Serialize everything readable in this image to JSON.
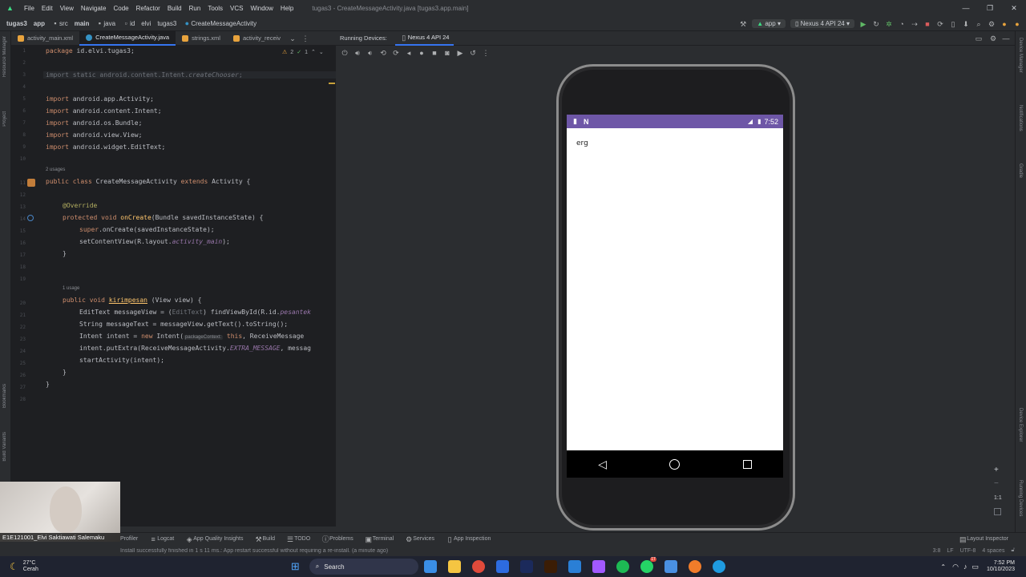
{
  "menubar": {
    "items": [
      "File",
      "Edit",
      "View",
      "Navigate",
      "Code",
      "Refactor",
      "Build",
      "Run",
      "Tools",
      "VCS",
      "Window",
      "Help"
    ],
    "title": "tugas3 - CreateMessageActivity.java [tugas3.app.main]"
  },
  "navbar": {
    "crumbs": [
      "tugas3",
      "app",
      "src",
      "main",
      "java",
      "id",
      "elvi",
      "tugas3",
      "CreateMessageActivity"
    ],
    "run_config": "app",
    "device": "Nexus 4 API 24"
  },
  "tabs": {
    "items": [
      "activity_main.xml",
      "CreateMessageActivity.java",
      "strings.xml",
      "activity_receiv"
    ]
  },
  "left_strip": {
    "labels": [
      "Resource Manager",
      "Project",
      "Bookmarks",
      "Build Variants"
    ]
  },
  "right_strip": {
    "labels": [
      "Device Manager",
      "Notifications",
      "Gradle",
      "Device Explorer",
      "Running Devices"
    ]
  },
  "editor": {
    "warnings": "2",
    "checks": "1",
    "usages_class": "2 usages",
    "usages_method": "1 usage",
    "line_numbers": [
      "1",
      "2",
      "3",
      "4",
      "5",
      "6",
      "7",
      "8",
      "9",
      "10",
      "11",
      "12",
      "13",
      "14",
      "15",
      "16",
      "17",
      "18",
      "19",
      "20",
      "21",
      "22",
      "23",
      "24",
      "25",
      "26",
      "27",
      "28"
    ],
    "lines": {
      "l1_kw": "package",
      "l1_rest": " id.elvi.tugas3;",
      "l3": "import static android.content.Intent.",
      "l3_it": "createChooser",
      "l3_end": ";",
      "l5": "android.app.Activity;",
      "l6": "android.content.Intent;",
      "l7": "android.os.Bundle;",
      "l8": "android.view.View;",
      "l9": "android.widget.EditText;",
      "import_kw": "import",
      "l11_a": "public class",
      "l11_b": " CreateMessageActivity ",
      "l11_c": "extends",
      "l11_d": " Activity {",
      "l13": "@Override",
      "l14_a": "protected void",
      "l14_b": "onCreate",
      "l14_c": "(Bundle savedInstanceState) {",
      "l15_a": "super",
      "l15_b": ".onCreate(savedInstanceState);",
      "l16_a": "setContentView(R.layout.",
      "l16_b": "activity_main",
      "l16_c": ");",
      "l17": "}",
      "l20_a": "public void",
      "l20_b": "kirimpesan",
      "l20_c": " (View view) {",
      "l21_a": "EditText messageView = (",
      "l21_b": "EditText",
      "l21_c": ") findViewById(R.id.",
      "l21_d": "pesantek",
      "l22": "String messageText = messageView.getText().toString();",
      "l23_a": "Intent intent = ",
      "l23_b": "new",
      "l23_c": " Intent(",
      "l23_hint": "packageContext:",
      "l23_d": "this",
      "l23_e": ", ReceiveMessage",
      "l24_a": "intent.putExtra(ReceiveMessageActivity.",
      "l24_b": "EXTRA_MESSAGE",
      "l24_c": ", messag",
      "l25": "startActivity(intent);",
      "l26": "}",
      "l27": "}"
    }
  },
  "running_devices": {
    "label": "Running Devices:",
    "tab": "Nexus 4 API 24"
  },
  "phone": {
    "time": "7:52",
    "content_text": "erg"
  },
  "bottom_tabs": [
    "Profiler",
    "Logcat",
    "App Quality Insights",
    "Build",
    "TODO",
    "Problems",
    "Terminal",
    "Services",
    "App Inspection"
  ],
  "layout_inspector": "Layout Inspector",
  "statusline": {
    "message": "Install successfully finished in 1 s 11 ms.: App restart successful without requiring a re-install. (a minute ago)",
    "position": "3:8",
    "line_sep": "LF",
    "encoding": "UTF-8",
    "indent": "4 spaces"
  },
  "webcam": {
    "name": "E1E121001_Elvi Saktiawati Salemaku"
  },
  "taskbar": {
    "temp": "27°C",
    "weather": "Cerah",
    "search": "Search",
    "time": "7:52 PM",
    "date": "10/10/2023",
    "badge": "17"
  },
  "zoom": {
    "plus": "+",
    "minus": "−",
    "ratio": "1:1"
  }
}
